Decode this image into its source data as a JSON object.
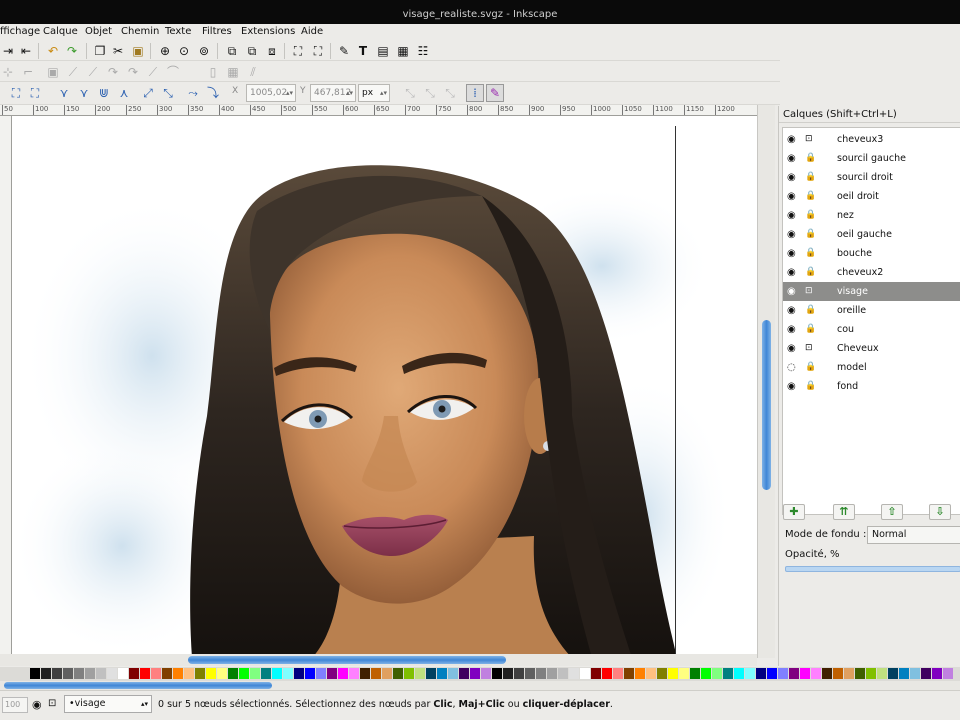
{
  "window": {
    "title": "visage_realiste.svgz - Inkscape"
  },
  "menu": [
    "ffichage",
    "Calque",
    "Objet",
    "Chemin",
    "Texte",
    "Filtres",
    "Extensions",
    "Aide"
  ],
  "toolbar_controls": {
    "x_label": "X",
    "x_value": "1005,02",
    "y_label": "Y",
    "y_value": "467,812",
    "unit": "px"
  },
  "ruler_ticks": [
    "50",
    "100",
    "150",
    "200",
    "250",
    "300",
    "350",
    "400",
    "450",
    "500",
    "550",
    "600",
    "650",
    "700",
    "750",
    "800",
    "850",
    "900",
    "950",
    "1000",
    "1050",
    "1100",
    "1150",
    "1200"
  ],
  "layers_panel": {
    "title": "Calques (Shift+Ctrl+L)",
    "layers": [
      {
        "name": "cheveux3",
        "selected": false
      },
      {
        "name": "sourcil gauche",
        "selected": false
      },
      {
        "name": "sourcil droit",
        "selected": false
      },
      {
        "name": "oeil droit",
        "selected": false
      },
      {
        "name": "nez",
        "selected": false
      },
      {
        "name": "oeil gauche",
        "selected": false
      },
      {
        "name": "bouche",
        "selected": false
      },
      {
        "name": "cheveux2",
        "selected": false
      },
      {
        "name": "visage",
        "selected": true
      },
      {
        "name": "oreille",
        "selected": false
      },
      {
        "name": "cou",
        "selected": false
      },
      {
        "name": "Cheveux",
        "selected": false
      },
      {
        "name": "model",
        "selected": false
      },
      {
        "name": "fond",
        "selected": false
      }
    ],
    "blend_label": "Mode de fondu :",
    "blend_value": "Normal",
    "opacity_label": "Opacité, %"
  },
  "statusbar": {
    "zoom": "100",
    "current_layer": "•visage",
    "message_prefix": "0 sur 5 nœuds sélectionnés. Sélectionnez des nœuds par ",
    "kw_click": "Clic",
    "sep1": ", ",
    "kw_shift": "Maj+Clic",
    "sep2": " ou ",
    "kw_drag": "cliquer-déplacer",
    "end": "."
  },
  "colors": {
    "selected_layer": "#8d8d8b",
    "scroll_accent": "#3f86d6",
    "add_button": "#2d8a2d"
  }
}
